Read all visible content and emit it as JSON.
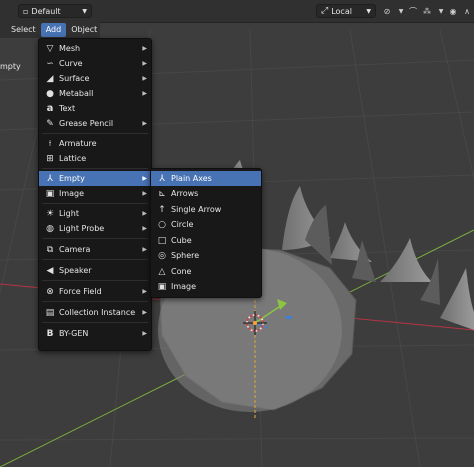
{
  "header": {
    "workspace_label": "Default",
    "orientation_label": "Local"
  },
  "menubar": {
    "items": [
      "Select",
      "Add",
      "Object"
    ]
  },
  "sidebar_partial_text": "mpty",
  "add_menu": {
    "items": [
      {
        "label": "Mesh",
        "icon": "mesh-icon",
        "submenu": true
      },
      {
        "label": "Curve",
        "icon": "curve-icon",
        "submenu": true
      },
      {
        "label": "Surface",
        "icon": "surface-icon",
        "submenu": true
      },
      {
        "label": "Metaball",
        "icon": "metaball-icon",
        "submenu": true
      },
      {
        "label": "Text",
        "icon": "text-icon",
        "submenu": false
      },
      {
        "label": "Grease Pencil",
        "icon": "grease-pencil-icon",
        "submenu": true
      },
      {
        "label": "Armature",
        "icon": "armature-icon",
        "submenu": false
      },
      {
        "label": "Lattice",
        "icon": "lattice-icon",
        "submenu": false
      },
      {
        "label": "Empty",
        "icon": "empty-icon",
        "submenu": true,
        "highlighted": true
      },
      {
        "label": "Image",
        "icon": "image-icon",
        "submenu": true
      },
      {
        "label": "Light",
        "icon": "light-icon",
        "submenu": true
      },
      {
        "label": "Light Probe",
        "icon": "light-probe-icon",
        "submenu": true
      },
      {
        "label": "Camera",
        "icon": "camera-icon",
        "submenu": true
      },
      {
        "label": "Speaker",
        "icon": "speaker-icon",
        "submenu": false
      },
      {
        "label": "Force Field",
        "icon": "force-field-icon",
        "submenu": true
      },
      {
        "label": "Collection Instance",
        "icon": "collection-instance-icon",
        "submenu": true
      },
      {
        "label": "BY-GEN",
        "icon": "bygen-icon",
        "submenu": true
      }
    ]
  },
  "empty_submenu": {
    "items": [
      {
        "label": "Plain Axes",
        "icon": "plain-axes-icon",
        "highlighted": true
      },
      {
        "label": "Arrows",
        "icon": "arrows-icon"
      },
      {
        "label": "Single Arrow",
        "icon": "single-arrow-icon"
      },
      {
        "label": "Circle",
        "icon": "circle-icon"
      },
      {
        "label": "Cube",
        "icon": "cube-icon"
      },
      {
        "label": "Sphere",
        "icon": "sphere-icon"
      },
      {
        "label": "Cone",
        "icon": "cone-icon"
      },
      {
        "label": "Image",
        "icon": "image-icon"
      }
    ]
  },
  "colors": {
    "accent": "#4772b3",
    "menu_bg": "#181818",
    "viewport_bg": "#3d3d3d",
    "x_axis": "#cc3344",
    "y_axis": "#8cc63f"
  }
}
